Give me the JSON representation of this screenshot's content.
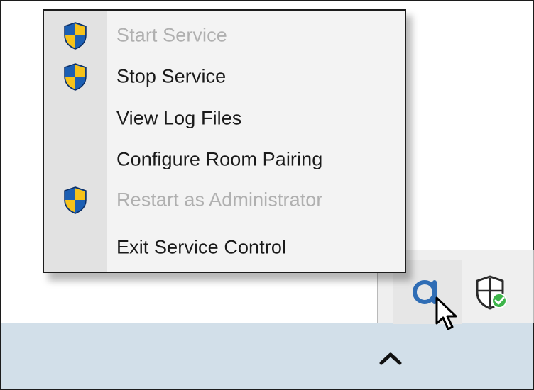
{
  "menu": {
    "items": [
      {
        "label": "Start Service",
        "icon": "uac-shield-icon",
        "enabled": false
      },
      {
        "label": "Stop Service",
        "icon": "uac-shield-icon",
        "enabled": true
      },
      {
        "label": "View Log Files",
        "icon": "",
        "enabled": true
      },
      {
        "label": "Configure Room Pairing",
        "icon": "",
        "enabled": true
      },
      {
        "label": "Restart as Administrator",
        "icon": "uac-shield-icon",
        "enabled": false
      },
      {
        "label": "Exit Service Control",
        "icon": "",
        "enabled": true
      }
    ]
  },
  "tray": {
    "icons": [
      "app-logo-icon",
      "security-shield-check-icon"
    ],
    "overflow_chevron": "chevron-up-icon"
  },
  "colors": {
    "taskbar": "#d2dfe9",
    "app_logo": "#2f6db5",
    "shield_blue": "#1c5fb3",
    "shield_yellow": "#f6c21a",
    "check_green": "#3db54a",
    "disabled_text": "#b0b0b0"
  }
}
